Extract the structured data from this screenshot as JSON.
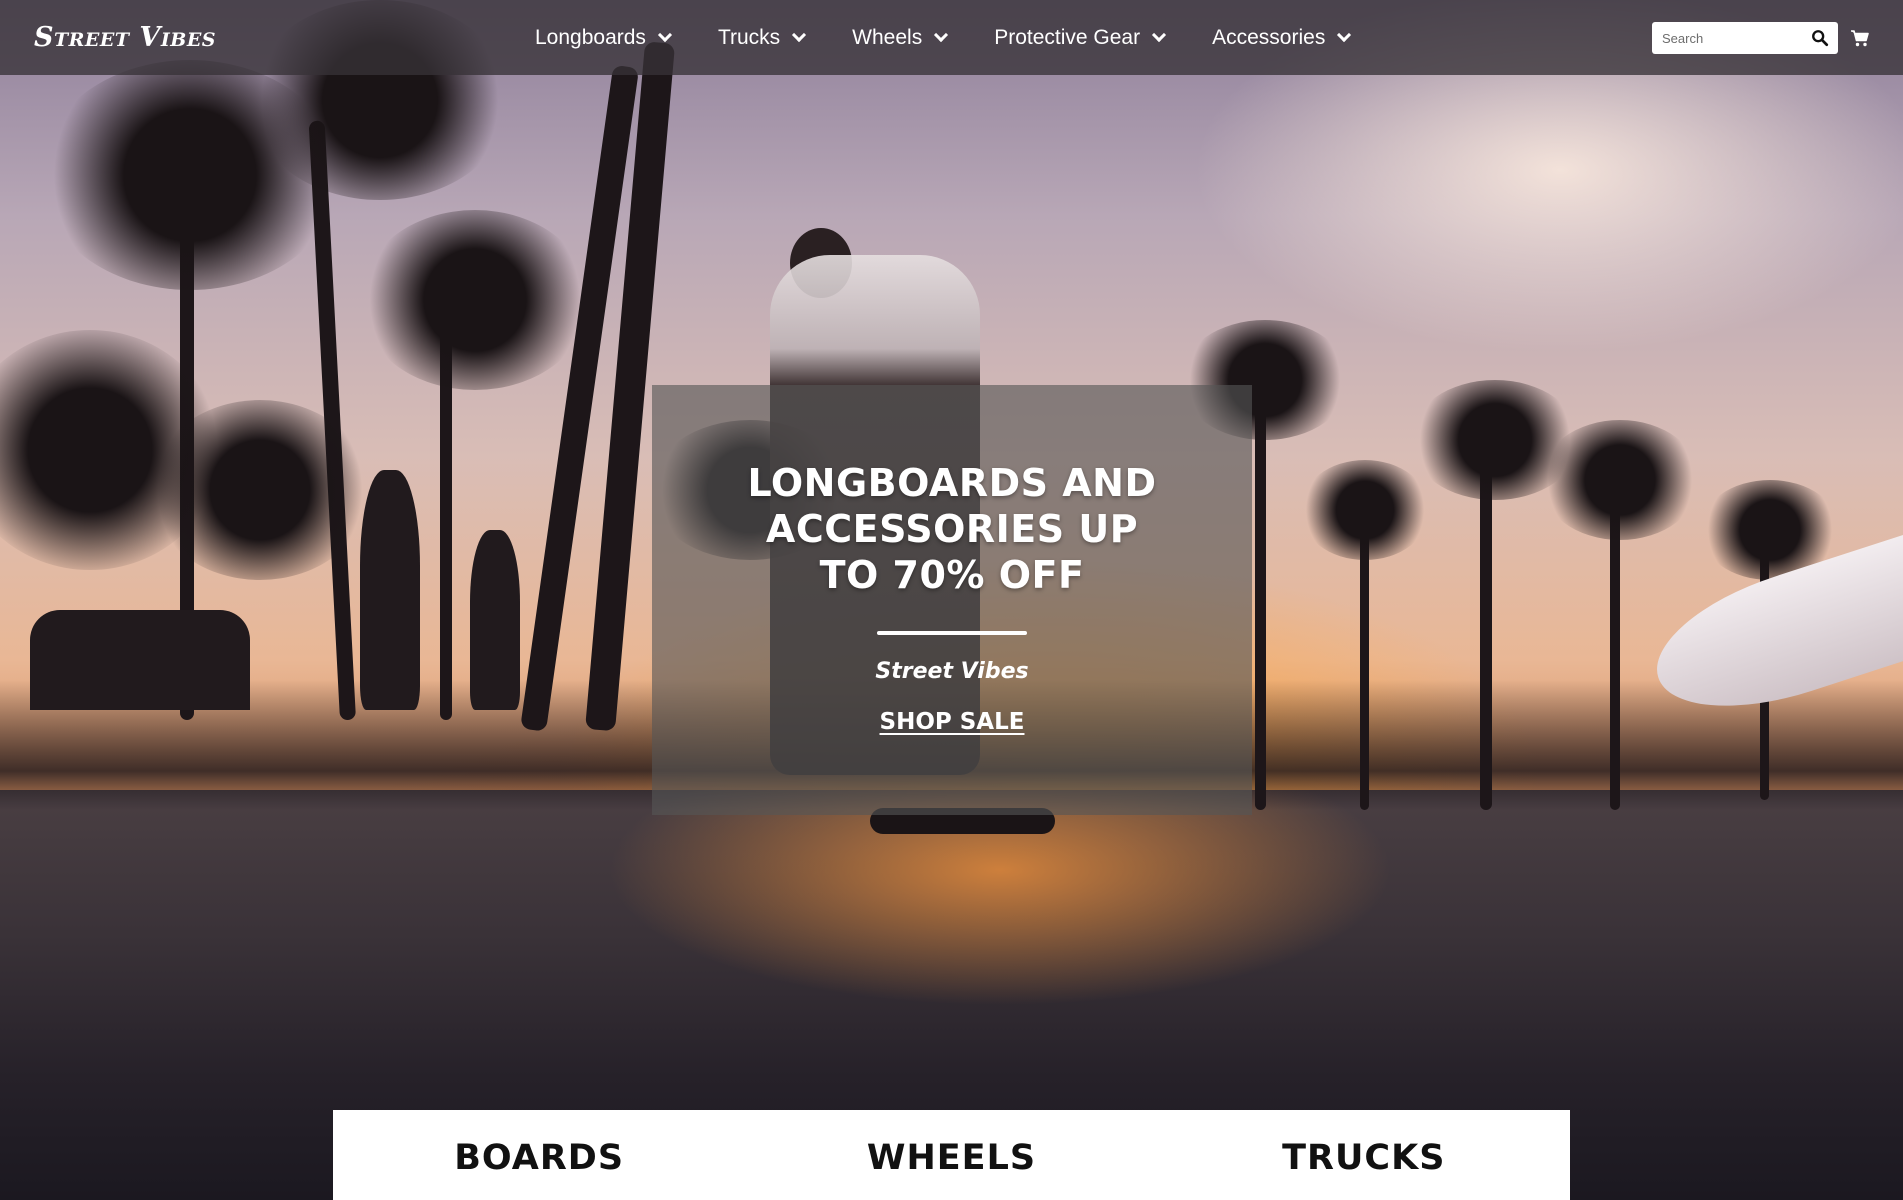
{
  "brand": {
    "logo_text": "Street Vibes"
  },
  "nav": {
    "items": [
      {
        "label": "Longboards"
      },
      {
        "label": "Trucks"
      },
      {
        "label": "Wheels"
      },
      {
        "label": "Protective Gear"
      },
      {
        "label": "Accessories"
      }
    ]
  },
  "search": {
    "placeholder": "Search",
    "value": ""
  },
  "icons": {
    "search": "search-icon",
    "cart": "cart-icon",
    "dropdown": "chevron-down-icon"
  },
  "promo": {
    "title": "LONGBOARDS AND ACCESSORIES UP TO 70% OFF",
    "brand": "Street Vibes",
    "cta": "SHOP SALE"
  },
  "categories": [
    {
      "label": "BOARDS"
    },
    {
      "label": "WHEELS"
    },
    {
      "label": "TRUCKS"
    }
  ],
  "colors": {
    "nav_bg": "#373237",
    "text": "#ffffff",
    "promo_bg": "#555555",
    "category_text": "#111111"
  }
}
